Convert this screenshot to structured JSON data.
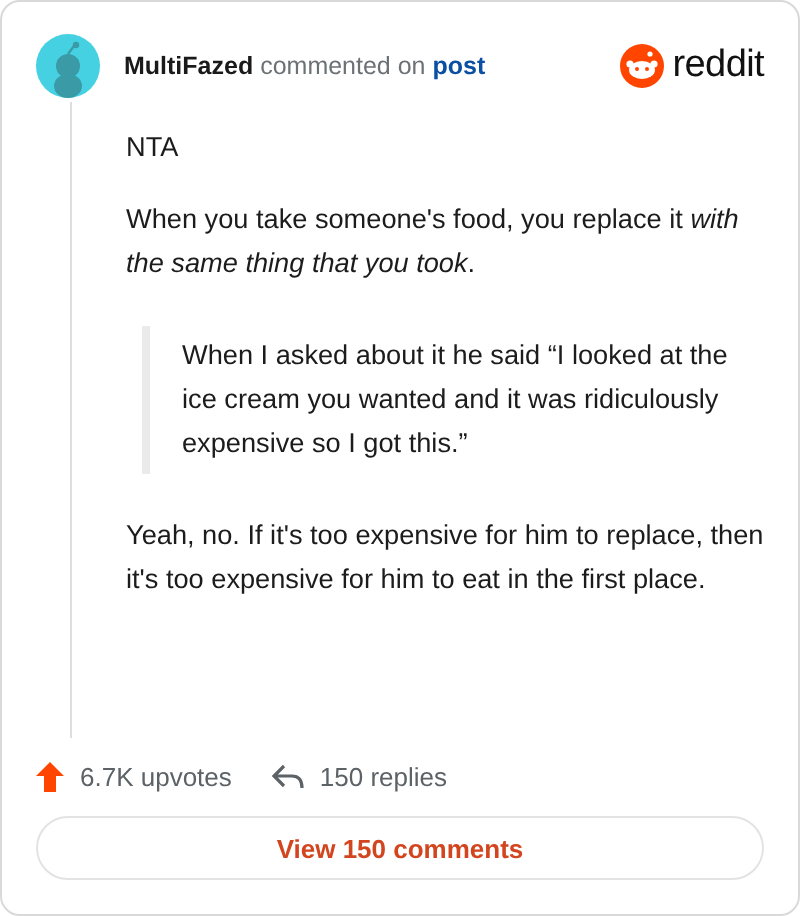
{
  "comment": {
    "author": "MultiFazed",
    "action": "commented on",
    "target": "post",
    "brand": "reddit"
  },
  "body": [
    {
      "kind": "paragraph",
      "text": "NTA"
    },
    {
      "kind": "paragraph",
      "text": "When you take someone's food, you replace it *with the same thing that you took*."
    },
    {
      "kind": "quote",
      "text": "When I asked about it he said “I looked at the ice cream you wanted and it was ridiculously expensive so I got this.”"
    },
    {
      "kind": "paragraph",
      "text": "Yeah, no. If it's too expensive for him to replace, then it's too expensive for him to eat in the first place."
    }
  ],
  "stats": {
    "upvotes": "6.7K upvotes",
    "replies": "150 replies"
  },
  "button": "View 150 comments"
}
